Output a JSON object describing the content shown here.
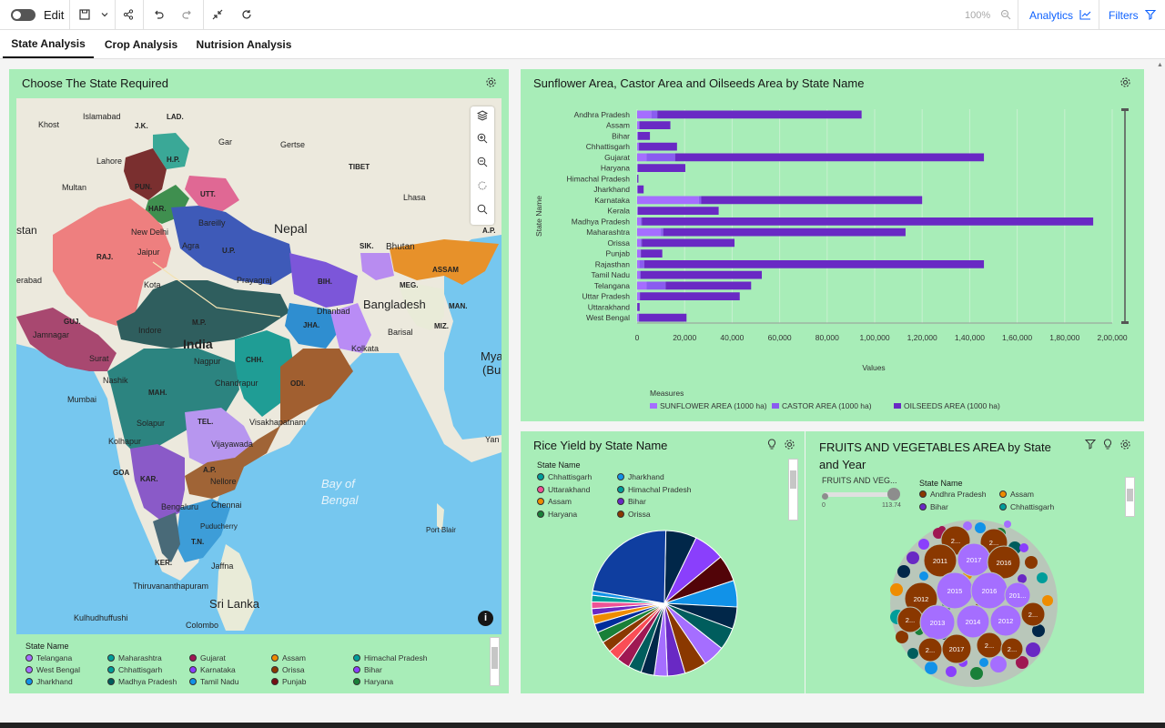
{
  "toolbar": {
    "edit": "Edit",
    "zoom": "100%",
    "analytics": "Analytics",
    "filters": "Filters"
  },
  "tabs": [
    "State Analysis",
    "Crop Analysis",
    "Nutrision Analysis"
  ],
  "map_panel": {
    "title": "Choose The State Required",
    "labels": {
      "stan": "stan",
      "khost": "Khost",
      "islamabad": "Islamabad",
      "lad": "LAD.",
      "jk": "J.K.",
      "gar": "Gar",
      "gertse": "Gertse",
      "tibet": "TIBET",
      "lahore": "Lahore",
      "hp": "H.P.",
      "multan": "Multan",
      "pun": "PUN.",
      "utt": "UTT.",
      "lhasa": "Lhasa",
      "har": "HAR.",
      "bareilly": "Bareilly",
      "nepal": "Nepal",
      "newdelhi": "New Delhi",
      "ap_top": "A.P.",
      "raj": "RAJ.",
      "jaipur": "Jaipur",
      "agra": "Agra",
      "up": "U.P.",
      "sik": "SIK.",
      "bhutan": "Bhutan",
      "erabad": "erabad",
      "kota": "Kota",
      "prayagraj": "Prayagraj",
      "assam": "ASSAM",
      "bih": "BIH.",
      "meg": "MEG.",
      "bangladesh": "Bangladesh",
      "man": "MAN.",
      "guj": "GUJ.",
      "mp": "M.P.",
      "dhanbad": "Dhanbad",
      "jha": "JHA.",
      "miz": "MIZ.",
      "jamnagar": "Jamnagar",
      "indore": "Indore",
      "india": "India",
      "barisal": "Barisal",
      "kolkata": "Kolkata",
      "mya": "Mya",
      "bu": "(Bu",
      "surat": "Surat",
      "nagpur": "Nagpur",
      "chh": "CHH.",
      "nashik": "Nashik",
      "chandrapur": "Chandrapur",
      "odi": "ODI.",
      "mumbai": "Mumbai",
      "mah": "MAH.",
      "solapur": "Solapur",
      "tel": "TEL.",
      "visakhapatnam": "Visakhapatnam",
      "kolhapur": "Kolhapur",
      "vijayawada": "Vijayawada",
      "yan": "Yan",
      "goa": "GOA",
      "ap": "A.P.",
      "kar": "KAR.",
      "nellore": "Nellore",
      "bay": "Bay of",
      "bengal": "Bengal",
      "bengaluru": "Bengaluru",
      "chennai": "Chennai",
      "puducherry": "Puducherry",
      "portblair": "Port Blair",
      "tn": "T.N.",
      "ker": "KER.",
      "jaffna": "Jaffna",
      "thiruvananthapuram": "Thiruvananthapuram",
      "srilanka": "Sri Lanka",
      "kulhudhuffushi": "Kulhudhuffushi",
      "colombo": "Colombo"
    },
    "legend_title": "State Name",
    "legend": [
      {
        "name": "Telangana",
        "color": "#a56eff"
      },
      {
        "name": "Maharashtra",
        "color": "#009d9a"
      },
      {
        "name": "Gujarat",
        "color": "#9f1853"
      },
      {
        "name": "Assam",
        "color": "#ee8c00"
      },
      {
        "name": "Himachal Pradesh",
        "color": "#009d9a"
      },
      {
        "name": "West Bengal",
        "color": "#a56eff"
      },
      {
        "name": "Chhattisgarh",
        "color": "#009d9a"
      },
      {
        "name": "Karnataka",
        "color": "#8a3ffc"
      },
      {
        "name": "Orissa",
        "color": "#8a3800"
      },
      {
        "name": "Bihar",
        "color": "#8a3ffc"
      },
      {
        "name": "Jharkhand",
        "color": "#1192e8"
      },
      {
        "name": "Madhya Pradesh",
        "color": "#005d5d"
      },
      {
        "name": "Tamil Nadu",
        "color": "#1192e8"
      },
      {
        "name": "Punjab",
        "color": "#750e13"
      },
      {
        "name": "Haryana",
        "color": "#198038"
      }
    ]
  },
  "bar_panel": {
    "title": "Sunflower Area, Castor Area and Oilseeds Area by State Name",
    "ylabel": "State Name",
    "xlabel": "Values",
    "measures_title": "Measures",
    "ticks": [
      "0",
      "20,000",
      "40,000",
      "60,000",
      "80,000",
      "1,00,000",
      "1,20,000",
      "1,40,000",
      "1,60,000",
      "1,80,000",
      "2,00,000"
    ]
  },
  "chart_data": {
    "type": "bar",
    "orientation": "horizontal",
    "categories": [
      "Andhra Pradesh",
      "Assam",
      "Bihar",
      "Chhattisgarh",
      "Gujarat",
      "Haryana",
      "Himachal Pradesh",
      "Jharkhand",
      "Karnataka",
      "Kerala",
      "Madhya Pradesh",
      "Maharashtra",
      "Orissa",
      "Punjab",
      "Rajasthan",
      "Tamil Nadu",
      "Telangana",
      "Uttar Pradesh",
      "Uttarakhand",
      "West Bengal"
    ],
    "series": [
      {
        "name": "SUNFLOWER AREA (1000 ha)",
        "color": "#a56eff",
        "values": [
          6000,
          800,
          300,
          600,
          4000,
          200,
          30,
          200,
          26000,
          300,
          1500,
          10000,
          1500,
          1500,
          1000,
          1000,
          4000,
          1000,
          50,
          700
        ]
      },
      {
        "name": "CASTOR AREA (1000 ha)",
        "color": "#8a5cf0",
        "values": [
          2500,
          200,
          100,
          200,
          12000,
          100,
          10,
          50,
          1000,
          30,
          500,
          1000,
          500,
          100,
          2000,
          500,
          8000,
          200,
          10,
          100
        ]
      },
      {
        "name": "OILSEEDS AREA (1000 ha)",
        "color": "#6929c4",
        "values": [
          86000,
          13000,
          5000,
          16000,
          130000,
          20000,
          500,
          2500,
          93000,
          34000,
          190000,
          102000,
          39000,
          9000,
          143000,
          51000,
          36000,
          42000,
          1000,
          20000
        ]
      }
    ],
    "xlim": [
      0,
      200000
    ],
    "stacked": true
  },
  "rice_panel": {
    "title": "Rice Yield by State Name",
    "legend_title": "State Name",
    "legend": [
      {
        "name": "Chhattisgarh",
        "color": "#009d9a"
      },
      {
        "name": "Jharkhand",
        "color": "#1192e8"
      },
      {
        "name": "Uttarakhand",
        "color": "#ee5396"
      },
      {
        "name": "Himachal Pradesh",
        "color": "#009d9a"
      },
      {
        "name": "Assam",
        "color": "#ee8c00"
      },
      {
        "name": "Bihar",
        "color": "#6929c4"
      },
      {
        "name": "Haryana",
        "color": "#198038"
      },
      {
        "name": "Orissa",
        "color": "#8a3800"
      }
    ],
    "pie": [
      {
        "color": "#012749",
        "value": 7
      },
      {
        "color": "#8a3ffc",
        "value": 7
      },
      {
        "color": "#520408",
        "value": 6
      },
      {
        "color": "#1192e8",
        "value": 6
      },
      {
        "color": "#012749",
        "value": 5
      },
      {
        "color": "#005d5d",
        "value": 5
      },
      {
        "color": "#a56eff",
        "value": 5
      },
      {
        "color": "#8a3800",
        "value": 5
      },
      {
        "color": "#6929c4",
        "value": 4
      },
      {
        "color": "#a56eff",
        "value": 3
      },
      {
        "color": "#012749",
        "value": 3
      },
      {
        "color": "#005d5d",
        "value": 3
      },
      {
        "color": "#9f1853",
        "value": 3
      },
      {
        "color": "#fa4d56",
        "value": 2.5
      },
      {
        "color": "#8a3800",
        "value": 2.5
      },
      {
        "color": "#198038",
        "value": 2.5
      },
      {
        "color": "#002d9c",
        "value": 2
      },
      {
        "color": "#ee8c00",
        "value": 2
      },
      {
        "color": "#6929c4",
        "value": 1.5
      },
      {
        "color": "#ee5396",
        "value": 1.5
      },
      {
        "color": "#009d9a",
        "value": 1.5
      },
      {
        "color": "#1192e8",
        "value": 1
      },
      {
        "color": "#0f3ea0",
        "value": 23
      }
    ]
  },
  "fruit_panel": {
    "title": "FRUITS AND VEGETABLES AREA by State and Year",
    "slider_label": "FRUITS AND VEG...",
    "slider_min": "0",
    "slider_max": "113.74",
    "legend_title": "State Name",
    "legend": [
      {
        "name": "Andhra Pradesh",
        "color": "#8a3800"
      },
      {
        "name": "Assam",
        "color": "#ee8c00"
      },
      {
        "name": "Bihar",
        "color": "#6929c4"
      },
      {
        "name": "Chhattisgarh",
        "color": "#009d9a"
      }
    ],
    "bubbles": [
      {
        "label": "2...",
        "color": "#8a3800"
      },
      {
        "label": "2...",
        "color": "#8a3800"
      },
      {
        "label": "2011",
        "color": "#8a3800"
      },
      {
        "label": "2017",
        "color": "#a56eff"
      },
      {
        "label": "2016",
        "color": "#8a3800"
      },
      {
        "label": "2012",
        "color": "#8a3800"
      },
      {
        "label": "2015",
        "color": "#a56eff"
      },
      {
        "label": "2016",
        "color": "#a56eff"
      },
      {
        "label": "201...",
        "color": "#a56eff"
      },
      {
        "label": "2...",
        "color": "#8a3800"
      },
      {
        "label": "2013",
        "color": "#a56eff"
      },
      {
        "label": "2014",
        "color": "#a56eff"
      },
      {
        "label": "2012",
        "color": "#a56eff"
      },
      {
        "label": "2...",
        "color": "#8a3800"
      },
      {
        "label": "2...",
        "color": "#8a3800"
      },
      {
        "label": "2017",
        "color": "#8a3800"
      },
      {
        "label": "2...",
        "color": "#8a3800"
      },
      {
        "label": "2...",
        "color": "#8a3800"
      }
    ]
  }
}
